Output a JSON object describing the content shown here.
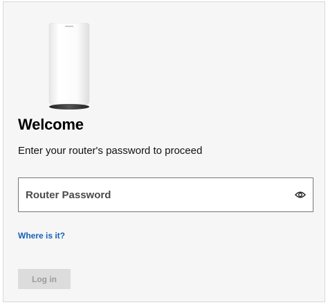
{
  "login": {
    "title": "Welcome",
    "subtitle": "Enter your router's password to proceed",
    "password_placeholder": "Router Password",
    "password_value": "",
    "help_link": "Where is it?",
    "login_button": "Log in",
    "login_enabled": false
  },
  "icons": {
    "router": "router-device-image",
    "toggle": "eye-icon"
  },
  "colors": {
    "link": "#1460b8",
    "button_disabled_bg": "#dcdcdc",
    "button_disabled_text": "#9b9b9b",
    "card_background": "#f6f6f6"
  }
}
